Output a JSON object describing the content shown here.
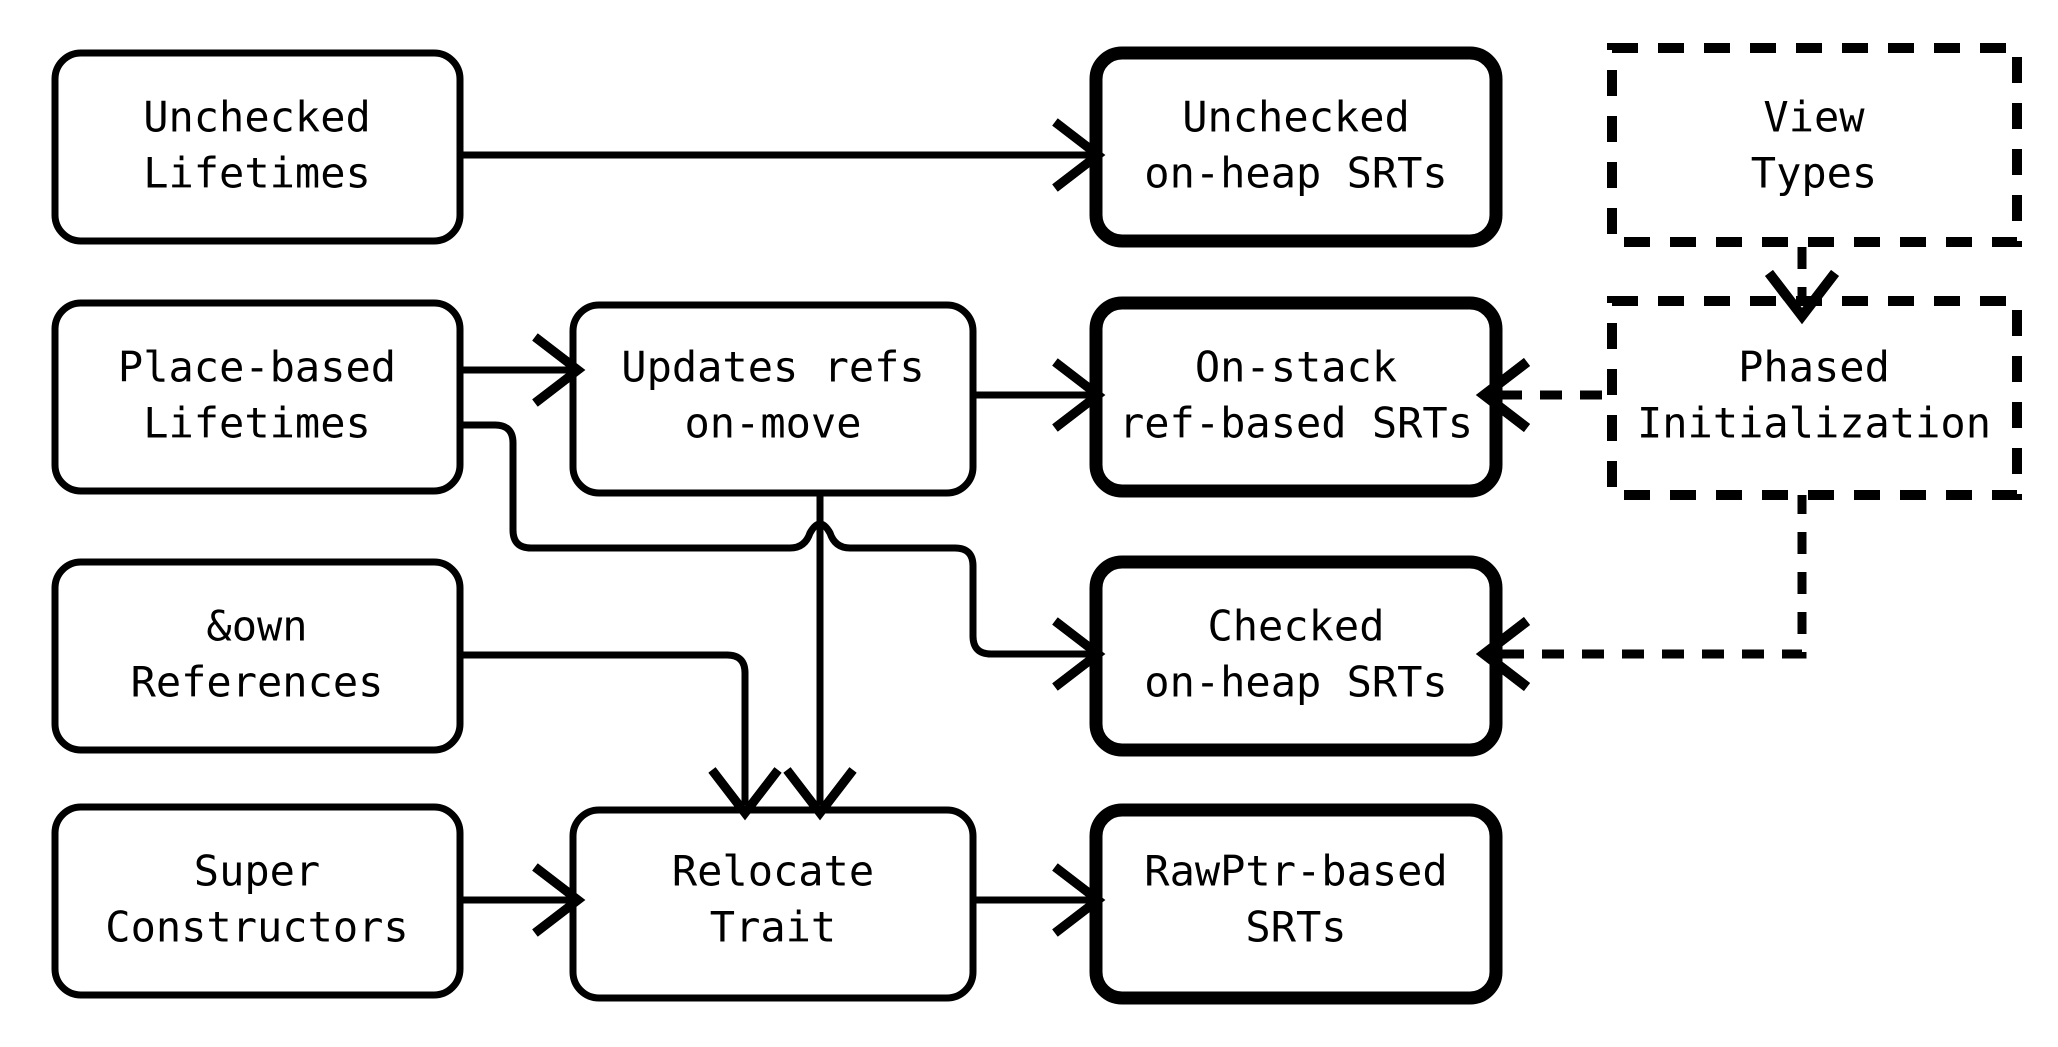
{
  "diagram": {
    "title": "Rust SRT design dependency diagram",
    "background_color": "#ffffff",
    "line_color": "#000000",
    "nodes": [
      {
        "id": "unchecked-lifetimes",
        "line1": "Unchecked",
        "line2": "Lifetimes",
        "style": "solid-rounded",
        "column": "left",
        "row": 1
      },
      {
        "id": "place-based-lifetimes",
        "line1": "Place-based",
        "line2": "Lifetimes",
        "style": "solid-rounded",
        "column": "left",
        "row": 2
      },
      {
        "id": "own-references",
        "line1": "&own",
        "line2": "References",
        "style": "solid-rounded",
        "column": "left",
        "row": 3
      },
      {
        "id": "super-constructors",
        "line1": "Super",
        "line2": "Constructors",
        "style": "solid-rounded",
        "column": "left",
        "row": 4
      },
      {
        "id": "updates-refs-on-move",
        "line1": "Updates refs",
        "line2": "on-move",
        "style": "solid-rounded",
        "column": "middle",
        "row": 2
      },
      {
        "id": "relocate-trait",
        "line1": "Relocate",
        "line2": "Trait",
        "style": "solid-rounded",
        "column": "middle",
        "row": 4
      },
      {
        "id": "unchecked-on-heap-srts",
        "line1": "Unchecked",
        "line2": "on-heap SRTs",
        "style": "bold-rounded",
        "column": "right",
        "row": 1
      },
      {
        "id": "on-stack-ref-based-srts",
        "line1": "On-stack",
        "line2": "ref-based SRTs",
        "style": "bold-rounded",
        "column": "right",
        "row": 2
      },
      {
        "id": "checked-on-heap-srts",
        "line1": "Checked",
        "line2": "on-heap SRTs",
        "style": "bold-rounded",
        "column": "right",
        "row": 3
      },
      {
        "id": "rawptr-based-srts",
        "line1": "RawPtr-based",
        "line2": "SRTs",
        "style": "bold-rounded",
        "column": "right",
        "row": 4
      },
      {
        "id": "view-types",
        "line1": "View",
        "line2": "Types",
        "style": "dashed-square",
        "column": "far-right",
        "row": 1
      },
      {
        "id": "phased-initialization",
        "line1": "Phased",
        "line2": "Initialization",
        "style": "dashed-square",
        "column": "far-right",
        "row": 2
      }
    ],
    "edges": [
      {
        "id": "e1",
        "from": "unchecked-lifetimes",
        "to": "unchecked-on-heap-srts",
        "style": "solid"
      },
      {
        "id": "e2",
        "from": "place-based-lifetimes",
        "to": "updates-refs-on-move",
        "style": "solid"
      },
      {
        "id": "e3",
        "from": "place-based-lifetimes",
        "to": "checked-on-heap-srts",
        "style": "solid"
      },
      {
        "id": "e4",
        "from": "updates-refs-on-move",
        "to": "on-stack-ref-based-srts",
        "style": "solid"
      },
      {
        "id": "e5",
        "from": "updates-refs-on-move",
        "to": "relocate-trait",
        "style": "solid"
      },
      {
        "id": "e6",
        "from": "own-references",
        "to": "relocate-trait",
        "style": "solid"
      },
      {
        "id": "e7",
        "from": "super-constructors",
        "to": "relocate-trait",
        "style": "solid"
      },
      {
        "id": "e8",
        "from": "relocate-trait",
        "to": "rawptr-based-srts",
        "style": "solid"
      },
      {
        "id": "e9",
        "from": "view-types",
        "to": "phased-initialization",
        "style": "dashed"
      },
      {
        "id": "e10",
        "from": "phased-initialization",
        "to": "on-stack-ref-based-srts",
        "style": "dashed"
      },
      {
        "id": "e11",
        "from": "phased-initialization",
        "to": "checked-on-heap-srts",
        "style": "dashed"
      }
    ]
  }
}
